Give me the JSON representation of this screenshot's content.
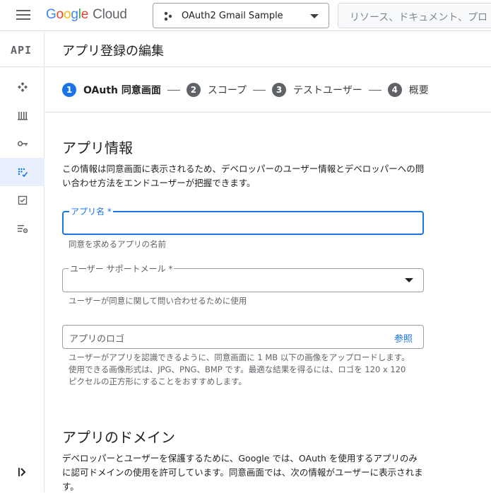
{
  "header": {
    "logo_google": [
      "G",
      "o",
      "o",
      "g",
      "l",
      "e"
    ],
    "logo_cloud": "Cloud",
    "project_name": "OAuth2 Gmail Sample",
    "search_placeholder": "リソース、ドキュメント、プロ"
  },
  "leftnav": {
    "api_label": "API",
    "items": [
      {
        "icon": "dashboard-icon",
        "active": false
      },
      {
        "icon": "library-icon",
        "active": false
      },
      {
        "icon": "key-icon",
        "active": false
      },
      {
        "icon": "oauth-consent-icon",
        "active": true
      },
      {
        "icon": "domain-verification-icon",
        "active": false
      },
      {
        "icon": "page-usage-settings-icon",
        "active": false
      }
    ],
    "expand_icon": "expand-sidebar-icon"
  },
  "page": {
    "title": "アプリ登録の編集",
    "steps": [
      {
        "num": "1",
        "label": "OAuth 同意画面",
        "active": true
      },
      {
        "num": "2",
        "label": "スコープ",
        "active": false
      },
      {
        "num": "3",
        "label": "テストユーザー",
        "active": false
      },
      {
        "num": "4",
        "label": "概要",
        "active": false
      }
    ]
  },
  "app_info": {
    "title": "アプリ情報",
    "desc": "この情報は同意画面に表示されるため、デベロッパーのユーザー情報とデベロッパーへの問い合わせ方法をエンドユーザーが把握できます。",
    "app_name_label": "アプリ名 *",
    "app_name_value": "",
    "app_name_hint": "同意を求めるアプリの名前",
    "support_email_label": "ユーザー サポートメール *",
    "support_email_hint": "ユーザーが同意に関して問い合わせるために使用",
    "logo_placeholder": "アプリのロゴ",
    "logo_browse": "参照",
    "logo_hint": "ユーザーがアプリを認識できるように、同意画面に 1 MB 以下の画像をアップロードします。使用できる画像形式は、JPG、PNG、BMP です。最適な結果を得るには、ロゴを 120 x 120 ピクセルの正方形にすることをおすすめします。"
  },
  "app_domain": {
    "title": "アプリのドメイン",
    "desc": "デベロッパーとユーザーを保護するために、Google では、OAuth を使用するアプリのみに認可ドメインの使用を許可しています。同意画面では、次の情報がユーザーに表示されます。"
  },
  "colors": {
    "accent": "#1a73e8",
    "active_nav_bg": "#e8f0fe",
    "text_primary": "#202124",
    "text_secondary": "#5f6368"
  }
}
